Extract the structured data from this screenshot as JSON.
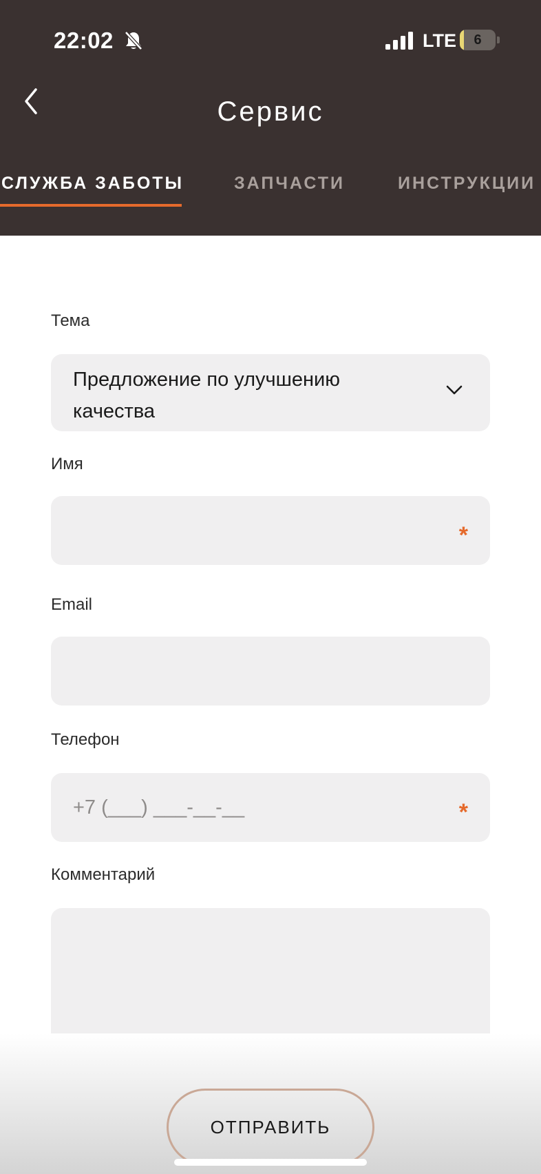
{
  "status_bar": {
    "time": "22:02",
    "network": "LTE",
    "battery_level": "6",
    "battery_fraction": 0.12,
    "icons": [
      "bell-slash-icon",
      "signal-bars-icon",
      "battery-icon"
    ]
  },
  "header": {
    "title": "Сервис",
    "back_icon": "chevron-left-icon"
  },
  "tabs": [
    {
      "label": "СЛУЖБА ЗАБОТЫ",
      "active": true
    },
    {
      "label": "ЗАПЧАСТИ",
      "active": false
    },
    {
      "label": "ИНСТРУКЦИИ",
      "active": false
    }
  ],
  "form": {
    "topic": {
      "label": "Тема",
      "value": "Предложение по улучшению качества",
      "icon": "chevron-down-icon"
    },
    "name": {
      "label": "Имя",
      "value": "",
      "required_mark": "*"
    },
    "email": {
      "label": "Email",
      "value": ""
    },
    "phone": {
      "label": "Телефон",
      "placeholder": "+7 (___) ___-__-__",
      "required_mark": "*"
    },
    "comment": {
      "label": "Комментарий",
      "value": ""
    },
    "submit_label": "ОТПРАВИТЬ"
  },
  "colors": {
    "header_bg": "#3a3130",
    "accent": "#e56a2c",
    "field_bg": "#f0eff0",
    "battery_fill": "#e8d774"
  }
}
